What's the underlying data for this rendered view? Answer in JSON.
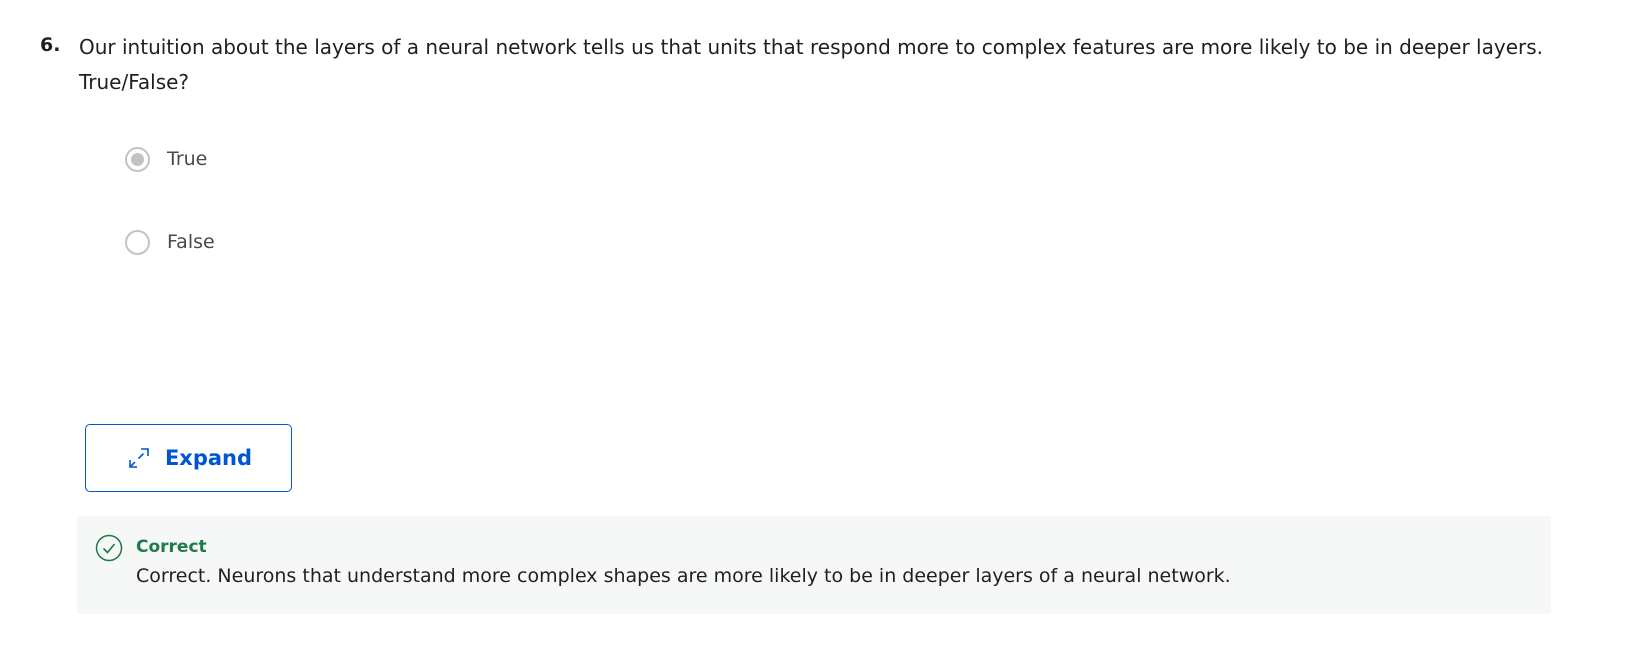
{
  "question": {
    "number": "6.",
    "text": "Our intuition about the layers of a neural network tells us that units that respond more to complex features are more likely to be in deeper layers. True/False?"
  },
  "options": [
    {
      "label": "True",
      "selected": true
    },
    {
      "label": "False",
      "selected": false
    }
  ],
  "expand_button": {
    "label": "Expand",
    "icon": "expand-arrows-icon"
  },
  "feedback": {
    "icon": "check-circle-icon",
    "title": "Correct",
    "text": "Correct. Neurons that understand more complex shapes are more likely to be in deeper layers of a neural network."
  },
  "colors": {
    "accent": "#0056d2",
    "success": "#1f7a4a",
    "feedback_bg": "#f5f8f6",
    "radio_disabled": "#c3c3c3"
  }
}
